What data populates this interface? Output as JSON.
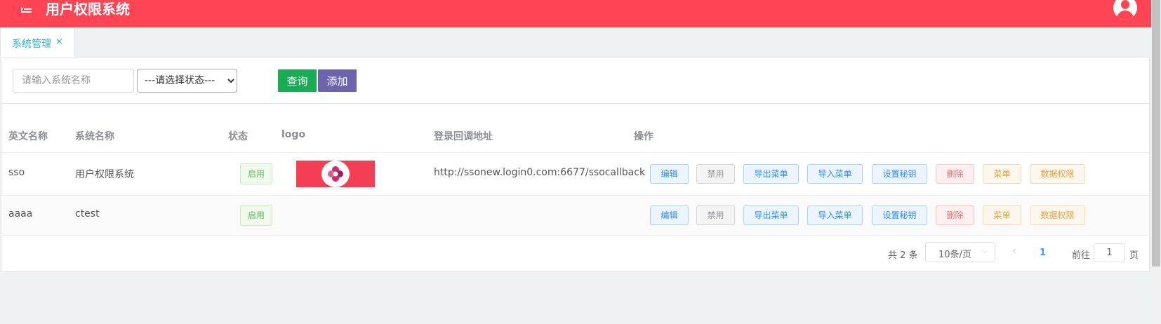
{
  "header": {
    "title": "用户权限系统"
  },
  "tabs": [
    {
      "label": "系统管理",
      "close": "×"
    }
  ],
  "search": {
    "name_placeholder": "请输入系统名称",
    "status_options": [
      "---请选择状态---"
    ],
    "query_label": "查询",
    "add_label": "添加"
  },
  "table": {
    "columns": [
      "英文名称",
      "系统名称",
      "状态",
      "logo",
      "登录回调地址",
      "操作"
    ],
    "rows": [
      {
        "en_name": "sso",
        "sys_name": "用户权限系统",
        "status": "启用",
        "callback": "http://ssonew.login0.com:6677/ssocallback"
      },
      {
        "en_name": "aaaa",
        "sys_name": "ctest",
        "status": "启用",
        "callback": ""
      }
    ],
    "actions": [
      "编辑",
      "禁用",
      "导出菜单",
      "导入菜单",
      "设置秘钥",
      "删除",
      "菜单",
      "数据权限"
    ]
  },
  "pagination": {
    "total": "共 2 条",
    "page_size": "10条/页",
    "current_page": "1",
    "goto_label": "前往",
    "goto_value": "1",
    "page_unit": "页"
  },
  "colors": {
    "brand": "#ff4454",
    "tab_accent": "#2ab3c8",
    "query_button": "#1aab56",
    "add_button": "#6d64b0"
  }
}
